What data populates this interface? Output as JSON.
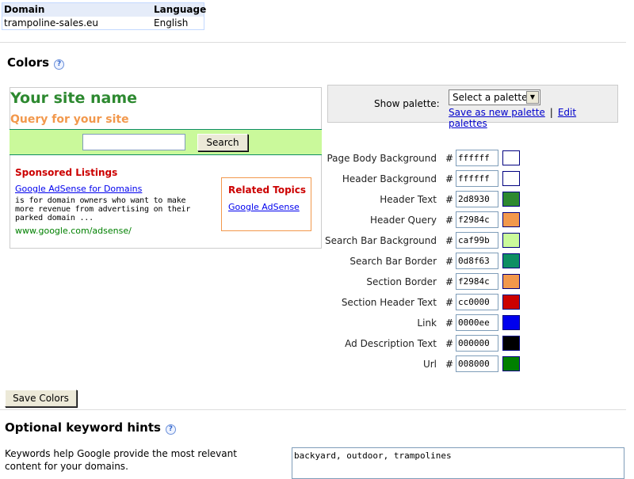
{
  "domain_table": {
    "headers": [
      "Domain",
      "Language"
    ],
    "row": [
      "trampoline-sales.eu",
      "English"
    ]
  },
  "colors_section": {
    "title": "Colors",
    "help": "?"
  },
  "preview": {
    "site_name": "Your site name",
    "query": "Query for your site",
    "search_button": "Search",
    "sponsored_title": "Sponsored Listings",
    "ad": {
      "link": "Google AdSense for Domains",
      "description": "is for domain owners who want to make more revenue from advertising on their parked domain ...",
      "url": "www.google.com/adsense/"
    },
    "related_title": "Related Topics",
    "related_link": "Google AdSense"
  },
  "palette": {
    "label": "Show palette:",
    "selected": "Select a palette",
    "save_link": "Save as new palette",
    "separator": "|",
    "edit_link": "Edit palettes"
  },
  "color_rows": [
    {
      "label": "Page Body Background",
      "hex": "ffffff",
      "color": "#ffffff"
    },
    {
      "label": "Header Background",
      "hex": "ffffff",
      "color": "#ffffff"
    },
    {
      "label": "Header Text",
      "hex": "2d8930",
      "color": "#2d8930"
    },
    {
      "label": "Header Query",
      "hex": "f2984c",
      "color": "#f2984c"
    },
    {
      "label": "Search Bar Background",
      "hex": "caf99b",
      "color": "#caf99b"
    },
    {
      "label": "Search Bar Border",
      "hex": "0d8f63",
      "color": "#0d8f63"
    },
    {
      "label": "Section Border",
      "hex": "f2984c",
      "color": "#f2984c"
    },
    {
      "label": "Section Header Text",
      "hex": "cc0000",
      "color": "#cc0000"
    },
    {
      "label": "Link",
      "hex": "0000ee",
      "color": "#0000ee"
    },
    {
      "label": "Ad Description Text",
      "hex": "000000",
      "color": "#000000"
    },
    {
      "label": "Url",
      "hex": "008000",
      "color": "#008000"
    }
  ],
  "hash_symbol": "#",
  "save_colors_button": "Save Colors",
  "keywords_section": {
    "title": "Optional keyword hints",
    "help": "?",
    "description": "Keywords help Google provide the most relevant content for your domains.",
    "value": "backyard, outdoor, trampolines"
  }
}
